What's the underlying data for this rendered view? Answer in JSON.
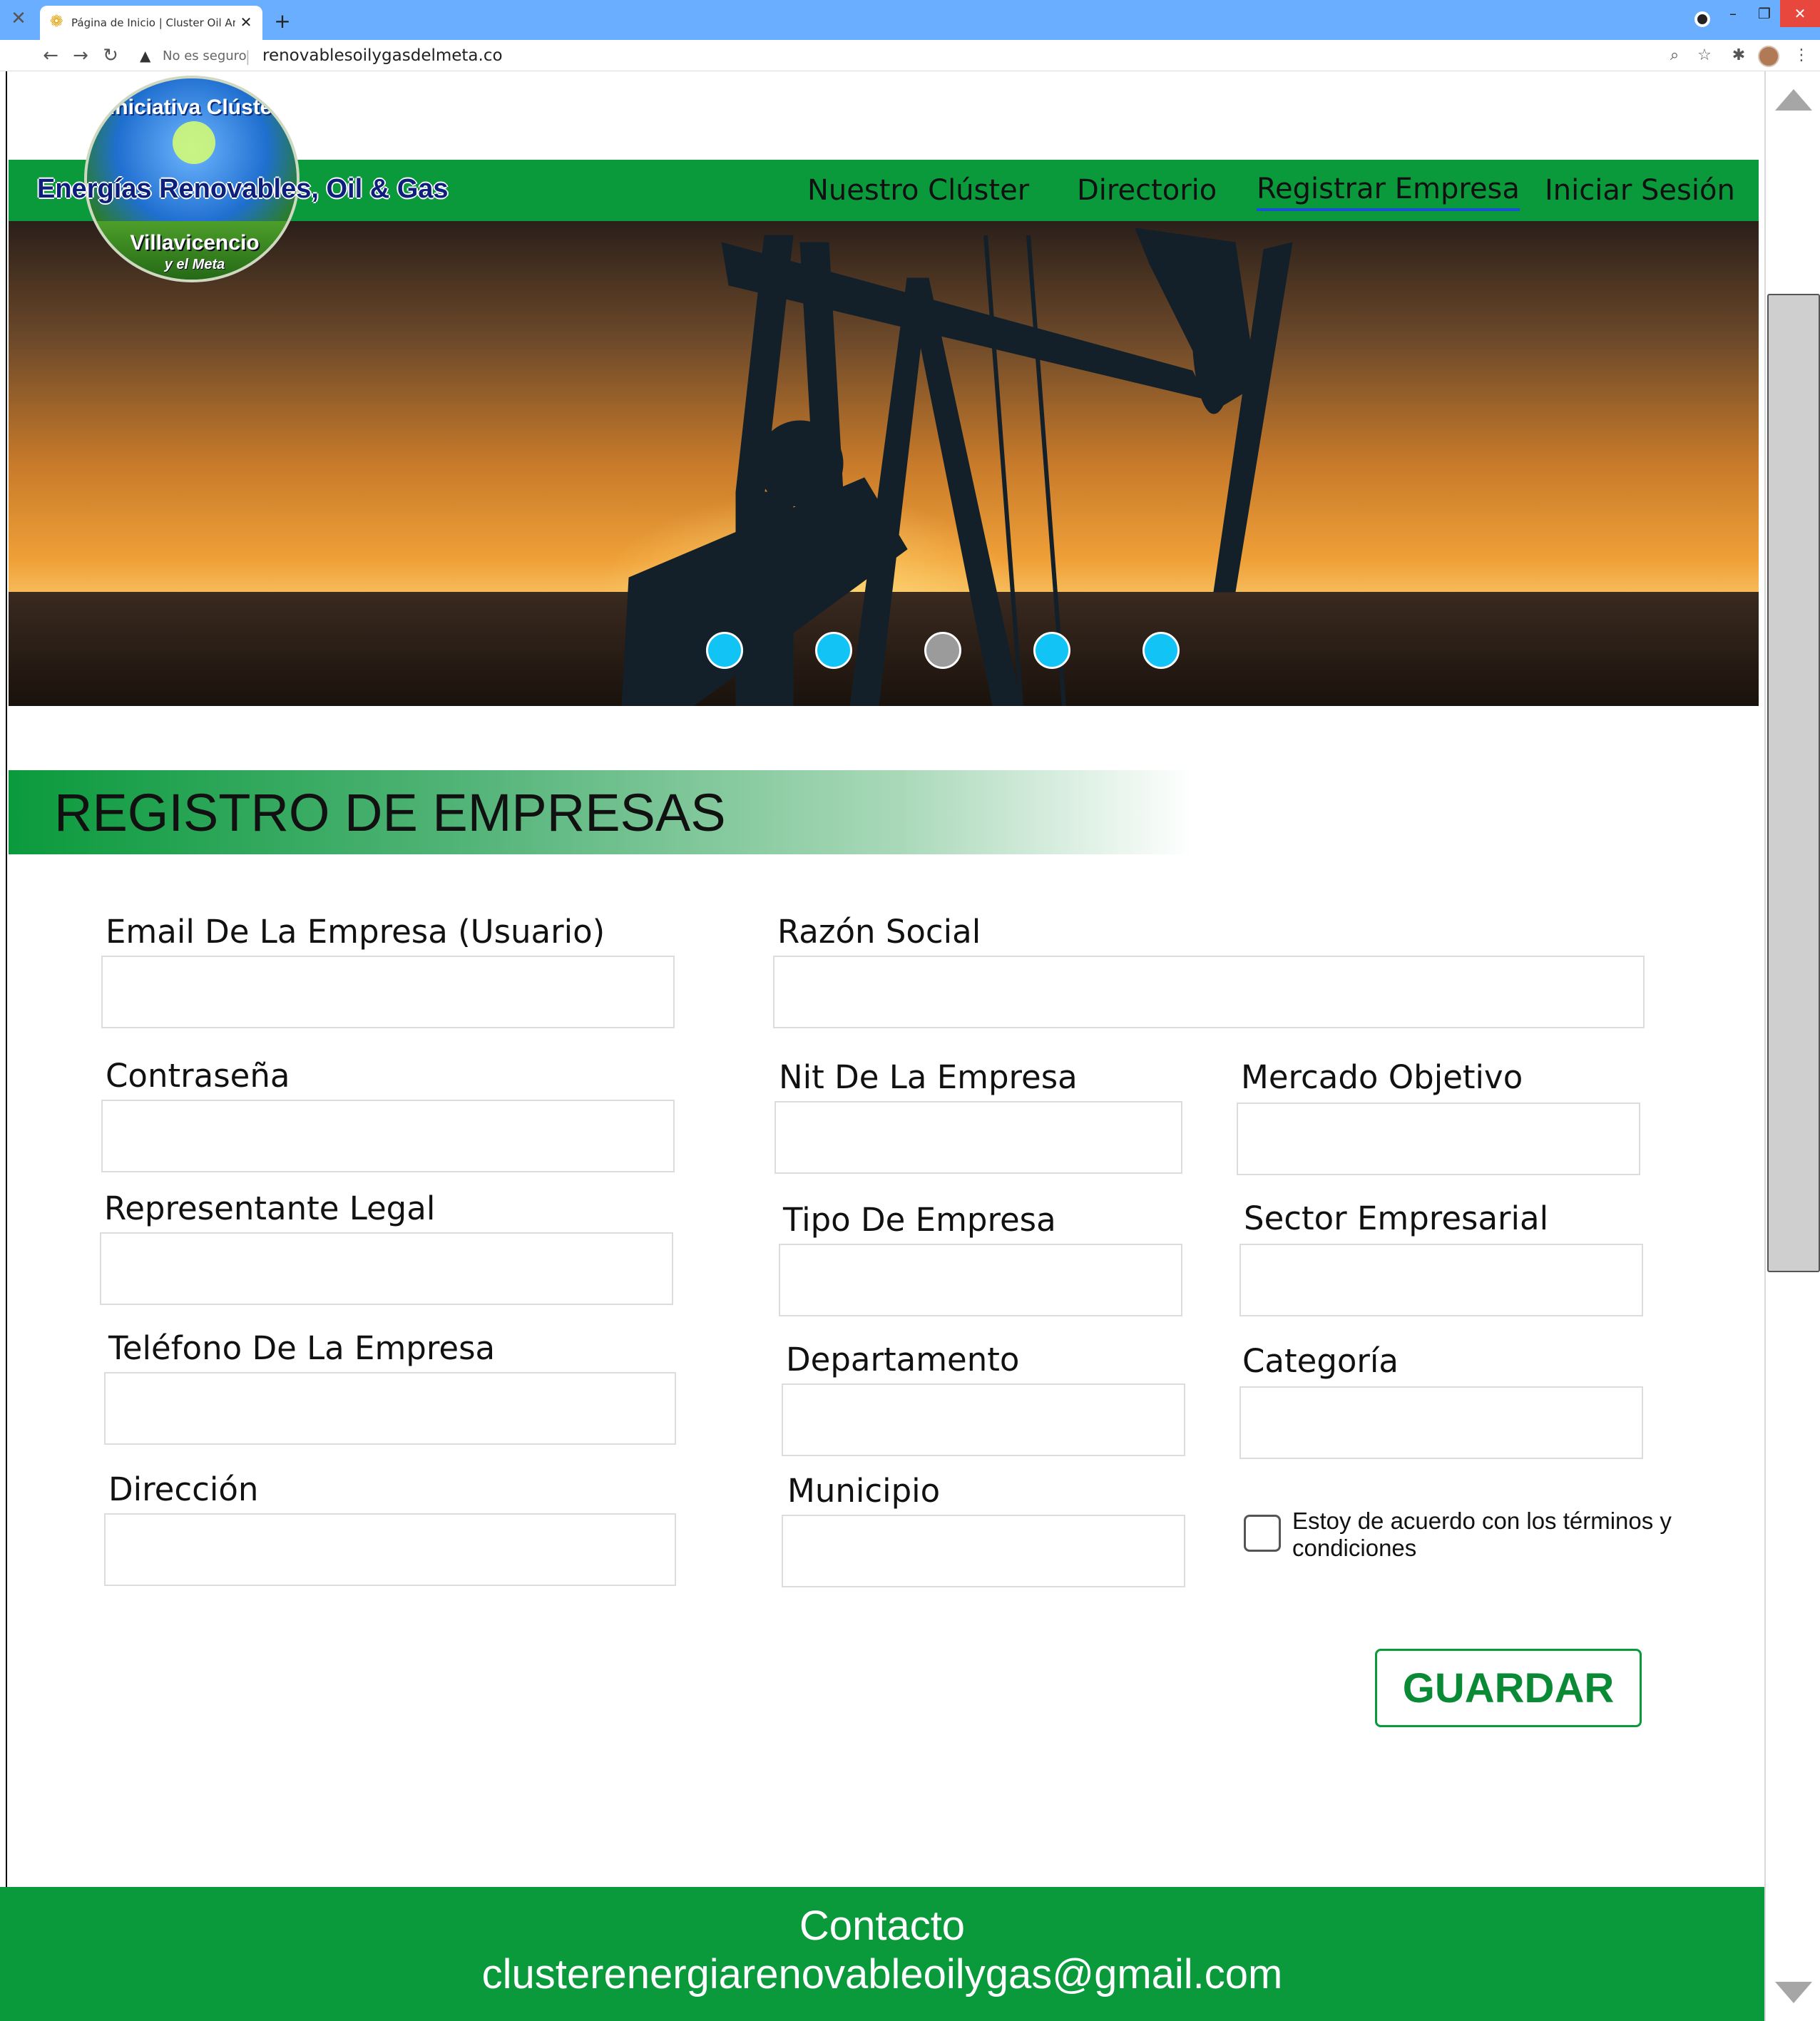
{
  "browser": {
    "tab_title": "Página de Inicio | Cluster Oil And",
    "new_tab": "+",
    "security_text": "No es seguro",
    "url": "renovablesoilygasdelmeta.co",
    "icons": [
      "back-icon",
      "forward-icon",
      "reload-icon",
      "warning-icon",
      "zoom-icon",
      "star-icon",
      "extensions-icon",
      "menu-icon"
    ]
  },
  "logo": {
    "line1": "Iniciativa Clúster",
    "line2": "Energías Renovables, Oil & Gas",
    "line3": "Villavicencio",
    "line4": "y el Meta"
  },
  "nav": {
    "items": [
      {
        "label": "Nuestro Clúster"
      },
      {
        "label": "Directorio"
      },
      {
        "label": "Registrar Empresa",
        "active": true
      },
      {
        "label": "Iniciar Sesión"
      }
    ]
  },
  "carousel": {
    "slides": 5,
    "active_index": 2
  },
  "form": {
    "title": "REGISTRO DE EMPRESAS",
    "email_label": "Email De La Empresa (Usuario)",
    "razon_label": "Razón Social",
    "password_label": "Contraseña",
    "nit_label": "Nit De La Empresa",
    "mercado_label": "Mercado Objetivo",
    "representante_label": "Representante Legal",
    "tipo_label": "Tipo De Empresa",
    "sector_label": "Sector Empresarial",
    "telefono_label": "Teléfono De La Empresa",
    "departamento_label": "Departamento",
    "categoria_label": "Categoría",
    "direccion_label": "Dirección",
    "municipio_label": "Municipio",
    "terms_text": "Estoy de acuerdo con los términos y condiciones",
    "save_label": "GUARDAR"
  },
  "footer": {
    "title": "Contacto",
    "email": "clusterenergiarenovableoilygas@gmail.com"
  },
  "colors": {
    "green": "#0a9a3c",
    "carousel_dot": "#12c3f5",
    "tabbar": "#6aaeff"
  }
}
